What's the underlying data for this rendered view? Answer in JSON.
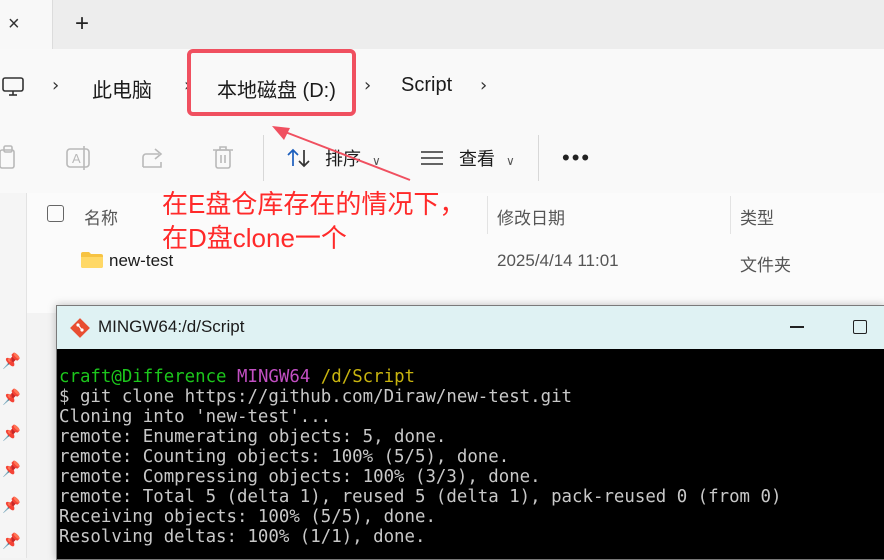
{
  "tabs": {
    "close_glyph": "×",
    "new_tab_glyph": "+"
  },
  "address": {
    "separator": "›",
    "crumbs": [
      "此电脑",
      "本地磁盘 (D:)",
      "Script"
    ]
  },
  "toolbar": {
    "sort_label": "排序",
    "view_label": "查看",
    "more_label": "•••"
  },
  "file_list": {
    "columns": {
      "name": "名称",
      "modified": "修改日期",
      "type": "类型"
    },
    "rows": [
      {
        "name": "new-test",
        "modified": "2025/4/14 11:01",
        "type": "文件夹"
      }
    ]
  },
  "annotation": {
    "line1": "在E盘仓库存在的情况下，",
    "line2": "在D盘clone一个",
    "color": "#ff2a2a"
  },
  "terminal": {
    "title": "MINGW64:/d/Script",
    "prompt_user": "craft@Difference",
    "prompt_env": "MINGW64",
    "prompt_path": "/d/Script",
    "lines": [
      "$ git clone https://github.com/Diraw/new-test.git",
      "Cloning into 'new-test'...",
      "remote: Enumerating objects: 5, done.",
      "remote: Counting objects: 100% (5/5), done.",
      "remote: Compressing objects: 100% (3/3), done.",
      "remote: Total 5 (delta 1), reused 5 (delta 1), pack-reused 0 (from 0)",
      "Receiving objects: 100% (5/5), done.",
      "Resolving deltas: 100% (1/1), done."
    ]
  },
  "colors": {
    "highlight": "#f05060",
    "prompt_user": "#1cc61c",
    "prompt_env": "#c24fc2",
    "prompt_path": "#c8b40f",
    "terminal_bg": "#000000"
  },
  "icons": [
    "pc-icon",
    "copy-icon",
    "rename-icon",
    "share-icon",
    "delete-icon",
    "sort-icon",
    "view-icon",
    "folder-icon",
    "pin-icon",
    "git-icon"
  ]
}
